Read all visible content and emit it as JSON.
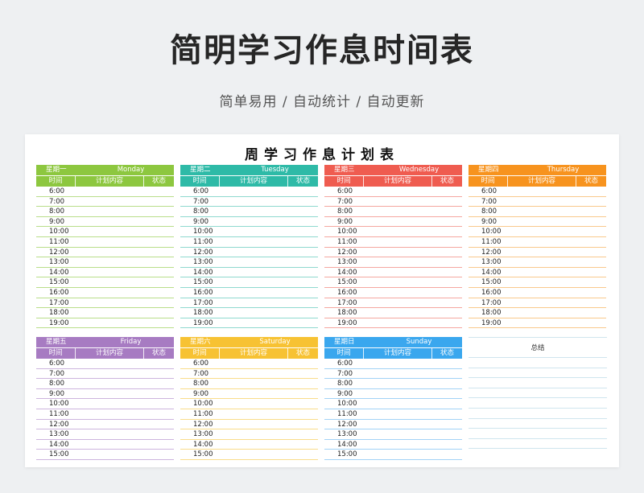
{
  "hero": {
    "title": "简明学习作息时间表",
    "subtitle": "简单易用 / 自动统计 / 自动更新"
  },
  "sheet": {
    "title": "周学习作息计划表",
    "columns": {
      "time": "时间",
      "plan": "计划内容",
      "status": "状态"
    },
    "summary_label": "总结",
    "days": [
      {
        "cn": "星期一",
        "en": "Monday",
        "color": "#8dc73f",
        "line": "#b9de8a",
        "times": [
          "6:00",
          "7:00",
          "8:00",
          "9:00",
          "10:00",
          "11:00",
          "12:00",
          "13:00",
          "14:00",
          "15:00",
          "16:00",
          "17:00",
          "18:00",
          "19:00"
        ]
      },
      {
        "cn": "星期二",
        "en": "Tuesday",
        "color": "#2ebaa7",
        "line": "#8fd9cf",
        "times": [
          "6:00",
          "7:00",
          "8:00",
          "9:00",
          "10:00",
          "11:00",
          "12:00",
          "13:00",
          "14:00",
          "15:00",
          "16:00",
          "17:00",
          "18:00",
          "19:00"
        ]
      },
      {
        "cn": "星期三",
        "en": "Wednesday",
        "color": "#ef5c50",
        "line": "#f5a7a0",
        "times": [
          "6:00",
          "7:00",
          "8:00",
          "9:00",
          "10:00",
          "11:00",
          "12:00",
          "13:00",
          "14:00",
          "15:00",
          "16:00",
          "17:00",
          "18:00",
          "19:00"
        ]
      },
      {
        "cn": "星期四",
        "en": "Thursday",
        "color": "#f7931e",
        "line": "#f9c98c",
        "times": [
          "6:00",
          "7:00",
          "8:00",
          "9:00",
          "10:00",
          "11:00",
          "12:00",
          "13:00",
          "14:00",
          "15:00",
          "16:00",
          "17:00",
          "18:00",
          "19:00"
        ]
      },
      {
        "cn": "星期五",
        "en": "Friday",
        "color": "#a77bc2",
        "line": "#cdb4de",
        "times": [
          "6:00",
          "7:00",
          "8:00",
          "9:00",
          "10:00",
          "11:00",
          "12:00",
          "13:00",
          "14:00",
          "15:00"
        ]
      },
      {
        "cn": "星期六",
        "en": "Saturday",
        "color": "#f7c233",
        "line": "#f9dc8a",
        "times": [
          "6:00",
          "7:00",
          "8:00",
          "9:00",
          "10:00",
          "11:00",
          "12:00",
          "13:00",
          "14:00",
          "15:00"
        ]
      },
      {
        "cn": "星期日",
        "en": "Sunday",
        "color": "#3aa7ee",
        "line": "#a2d2f6",
        "times": [
          "6:00",
          "7:00",
          "8:00",
          "9:00",
          "10:00",
          "11:00",
          "12:00",
          "13:00",
          "14:00",
          "15:00"
        ]
      }
    ]
  }
}
